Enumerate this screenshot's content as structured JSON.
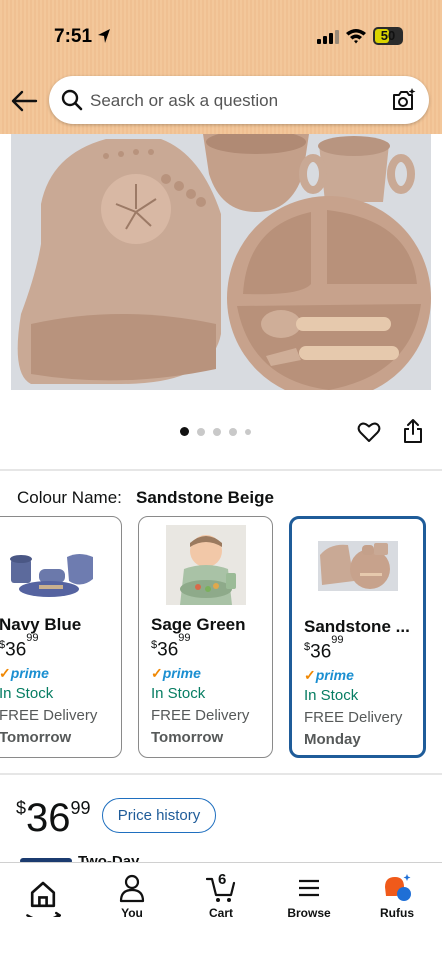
{
  "status_bar": {
    "time": "7:51",
    "battery": "50"
  },
  "search": {
    "placeholder": "Search or ask a question"
  },
  "gallery": {
    "image_count": 5,
    "active_index": 0
  },
  "colour": {
    "label": "Colour Name:",
    "selected": "Sandstone Beige"
  },
  "variants": [
    {
      "name": "Navy Blue",
      "currency": "$",
      "price_whole": "36",
      "price_cents": "99",
      "prime_check": "✓",
      "prime": "prime",
      "stock": "In Stock",
      "delivery": "FREE Delivery",
      "delivery_day": "Tomorrow"
    },
    {
      "name": "Sage Green",
      "currency": "$",
      "price_whole": "36",
      "price_cents": "99",
      "prime_check": "✓",
      "prime": "prime",
      "stock": "In Stock",
      "delivery": "FREE Delivery",
      "delivery_day": "Tomorrow"
    },
    {
      "name": "Sandstone ...",
      "currency": "$",
      "price_whole": "36",
      "price_cents": "99",
      "prime_check": "✓",
      "prime": "prime",
      "stock": "In Stock",
      "delivery": "FREE Delivery",
      "delivery_day": "Monday"
    }
  ],
  "price": {
    "currency": "$",
    "whole": "36",
    "cents": "99",
    "history_button": "Price history"
  },
  "peek": {
    "text": "Two-Day"
  },
  "nav": {
    "home": {
      "label": ""
    },
    "you": {
      "label": "You"
    },
    "cart": {
      "label": "Cart",
      "count": "6"
    },
    "browse": {
      "label": "Browse"
    },
    "rufus": {
      "label": "Rufus"
    }
  },
  "colors": {
    "header": "#f3c79a",
    "selected_border": "#1f5c99",
    "stock_green": "#067d62",
    "prime_orange": "#f08804",
    "prime_blue": "#1b8fd1"
  }
}
